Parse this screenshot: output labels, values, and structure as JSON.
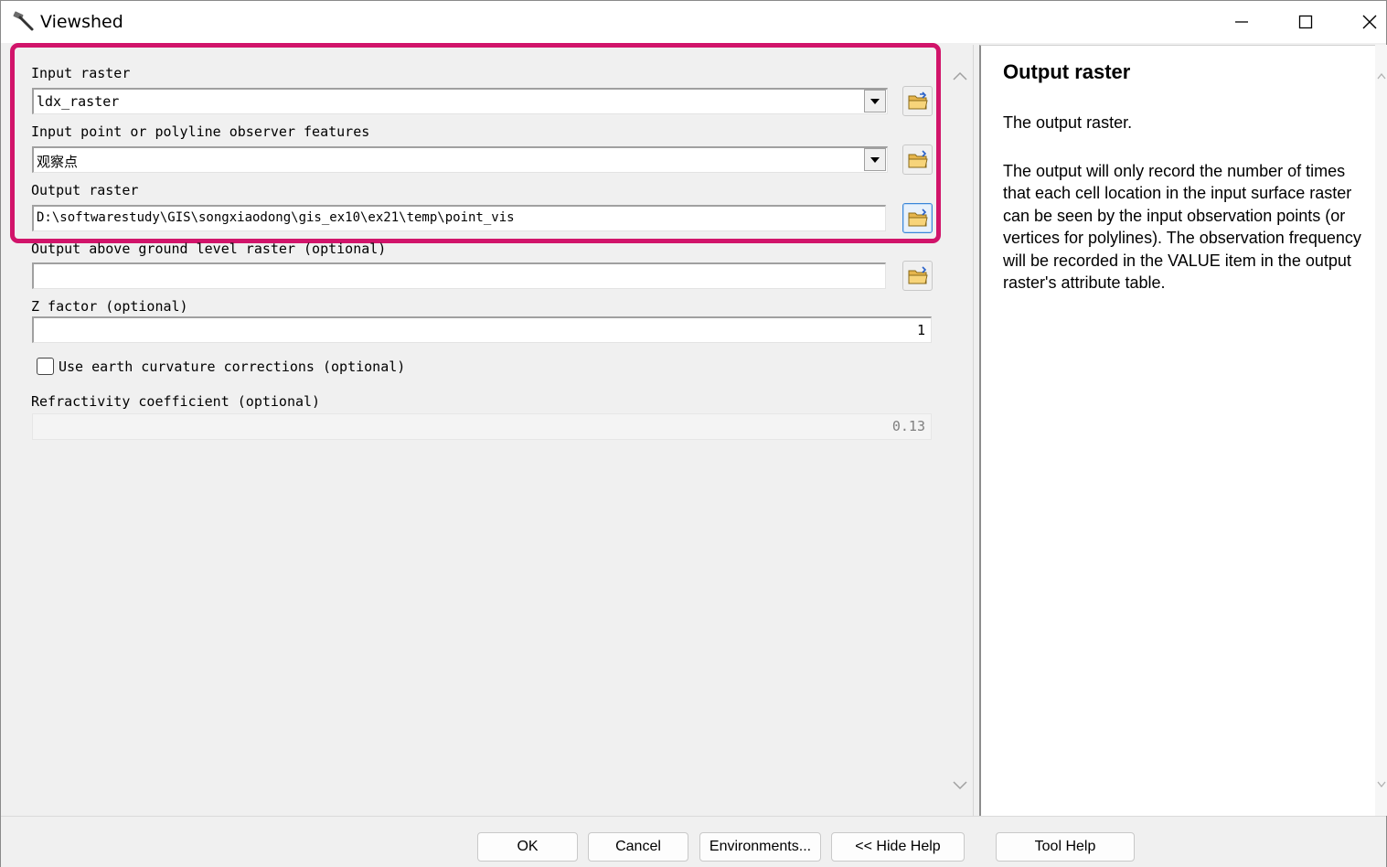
{
  "window": {
    "title": "Viewshed",
    "app_icon": "hammer-icon"
  },
  "params": {
    "input_raster": {
      "label": "Input raster",
      "value": "ldx_raster"
    },
    "observer_features": {
      "label": "Input point or polyline observer features",
      "value": "观察点"
    },
    "output_raster": {
      "label": "Output raster",
      "value": "D:\\softwarestudy\\GIS\\songxiaodong\\gis_ex10\\ex21\\temp\\point_vis"
    },
    "above_ground": {
      "label": "Output above ground level raster (optional)",
      "value": ""
    },
    "z_factor": {
      "label": "Z factor (optional)",
      "value": "1"
    },
    "earth_curvature": {
      "label": "Use earth curvature corrections (optional)",
      "checked": false
    },
    "refractivity": {
      "label": "Refractivity coefficient (optional)",
      "value": "0.13"
    }
  },
  "help": {
    "title": "Output raster",
    "paragraph1": "The output raster.",
    "paragraph2": "The output will only record the number of times that each cell location in the input surface raster can be seen by the input observation points (or vertices for polylines). The observation frequency will be recorded in the VALUE item in the output raster's attribute table."
  },
  "buttons": {
    "ok": "OK",
    "cancel": "Cancel",
    "environments": "Environments...",
    "hide_help": "<< Hide Help",
    "tool_help": "Tool Help"
  },
  "colors": {
    "highlight": "#d1146a",
    "window_bg": "#f0f0f0"
  }
}
